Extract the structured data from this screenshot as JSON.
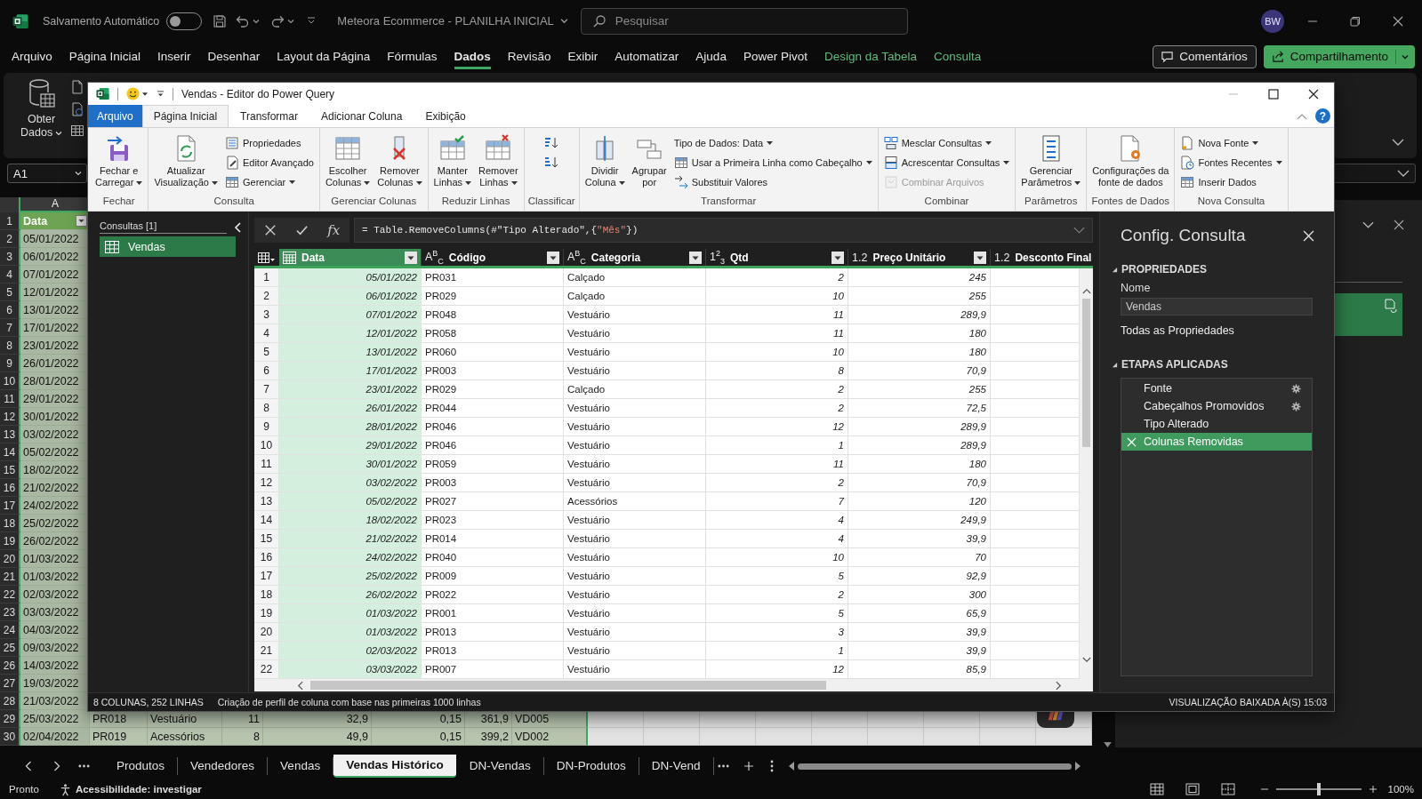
{
  "excel": {
    "title_bar": {
      "autosave": {
        "label": "Salvamento Automático",
        "on": false
      },
      "document_title": "Meteora Ecommerce - PLANILHA INICIAL",
      "search": {
        "placeholder": "Pesquisar"
      },
      "account_initials": "BW"
    },
    "menu_tabs": [
      {
        "label": "Arquivo",
        "selected": false,
        "kind": "standard"
      },
      {
        "label": "Página Inicial",
        "selected": false,
        "kind": "standard"
      },
      {
        "label": "Inserir",
        "selected": false,
        "kind": "standard"
      },
      {
        "label": "Desenhar",
        "selected": false,
        "kind": "standard"
      },
      {
        "label": "Layout da Página",
        "selected": false,
        "kind": "standard"
      },
      {
        "label": "Fórmulas",
        "selected": false,
        "kind": "standard"
      },
      {
        "label": "Dados",
        "selected": true,
        "kind": "standard"
      },
      {
        "label": "Revisão",
        "selected": false,
        "kind": "standard"
      },
      {
        "label": "Exibir",
        "selected": false,
        "kind": "standard"
      },
      {
        "label": "Automatizar",
        "selected": false,
        "kind": "standard"
      },
      {
        "label": "Ajuda",
        "selected": false,
        "kind": "standard"
      },
      {
        "label": "Power Pivot",
        "selected": false,
        "kind": "standard"
      },
      {
        "label": "Design da Tabela",
        "selected": false,
        "kind": "contextual"
      },
      {
        "label": "Consulta",
        "selected": false,
        "kind": "contextual"
      }
    ],
    "comments_button": "Comentários",
    "share_button": "Compartilhamento",
    "ribbon": {
      "get_data_button": "Obter\nDados"
    },
    "name_box": "A1",
    "sheet": {
      "column_headers": [
        "A"
      ],
      "rows": [
        {
          "number": "1",
          "kind": "header",
          "cells": [
            "Data"
          ]
        },
        {
          "number": "2",
          "kind": "data",
          "cells": [
            "05/01/2022"
          ]
        },
        {
          "number": "3",
          "kind": "data",
          "cells": [
            "06/01/2022"
          ]
        },
        {
          "number": "4",
          "kind": "data",
          "cells": [
            "07/01/2022"
          ]
        },
        {
          "number": "5",
          "kind": "data",
          "cells": [
            "12/01/2022"
          ]
        },
        {
          "number": "6",
          "kind": "data",
          "cells": [
            "13/01/2022"
          ]
        },
        {
          "number": "7",
          "kind": "data",
          "cells": [
            "17/01/2022"
          ]
        },
        {
          "number": "8",
          "kind": "data",
          "cells": [
            "23/01/2022"
          ]
        },
        {
          "number": "9",
          "kind": "data",
          "cells": [
            "26/01/2022"
          ]
        },
        {
          "number": "10",
          "kind": "data",
          "cells": [
            "28/01/2022"
          ]
        },
        {
          "number": "11",
          "kind": "data",
          "cells": [
            "29/01/2022"
          ]
        },
        {
          "number": "12",
          "kind": "data",
          "cells": [
            "30/01/2022"
          ]
        },
        {
          "number": "13",
          "kind": "data",
          "cells": [
            "03/02/2022"
          ]
        },
        {
          "number": "14",
          "kind": "data",
          "cells": [
            "05/02/2022"
          ]
        },
        {
          "number": "15",
          "kind": "data",
          "cells": [
            "18/02/2022"
          ]
        },
        {
          "number": "16",
          "kind": "data",
          "cells": [
            "21/02/2022"
          ]
        },
        {
          "number": "17",
          "kind": "data",
          "cells": [
            "24/02/2022"
          ]
        },
        {
          "number": "18",
          "kind": "data",
          "cells": [
            "25/02/2022"
          ]
        },
        {
          "number": "19",
          "kind": "data",
          "cells": [
            "26/02/2022"
          ]
        },
        {
          "number": "20",
          "kind": "data",
          "cells": [
            "01/03/2022"
          ]
        },
        {
          "number": "21",
          "kind": "data",
          "cells": [
            "01/03/2022"
          ]
        },
        {
          "number": "22",
          "kind": "data",
          "cells": [
            "02/03/2022"
          ]
        },
        {
          "number": "23",
          "kind": "data",
          "cells": [
            "03/03/2022"
          ]
        },
        {
          "number": "24",
          "kind": "data",
          "cells": [
            "04/03/2022"
          ]
        },
        {
          "number": "25",
          "kind": "data",
          "cells": [
            "09/03/2022"
          ]
        },
        {
          "number": "26",
          "kind": "data",
          "cells": [
            "14/03/2022"
          ]
        },
        {
          "number": "27",
          "kind": "data",
          "cells": [
            "19/03/2022"
          ]
        },
        {
          "number": "28",
          "kind": "data",
          "cells": [
            "21/03/2022"
          ]
        },
        {
          "number": "29",
          "kind": "data",
          "cells": [
            "25/03/2022",
            "PR018",
            "Vestuário",
            "11",
            "32,9",
            "0,15",
            "361,9",
            "VD005"
          ]
        },
        {
          "number": "30",
          "kind": "data",
          "cells": [
            "02/04/2022",
            "PR019",
            "Acessórios",
            "8",
            "49,9",
            "0,15",
            "399,2",
            "VD002"
          ]
        }
      ]
    },
    "sheet_tabs": [
      {
        "label": "Produtos",
        "selected": false
      },
      {
        "label": "Vendedores",
        "selected": false
      },
      {
        "label": "Vendas",
        "selected": false
      },
      {
        "label": "Vendas Histórico",
        "selected": true
      },
      {
        "label": "DN-Vendas",
        "selected": false
      },
      {
        "label": "DN-Produtos",
        "selected": false
      },
      {
        "label": "DN-Vend",
        "selected": false
      }
    ],
    "status_bar": {
      "status": "Pronto",
      "accessibility": "Acessibilidade: investigar",
      "zoom": {
        "level": 0.5,
        "label": "100%"
      }
    }
  },
  "power_query": {
    "title": "Vendas - Editor do Power Query",
    "tabs": [
      {
        "label": "Arquivo",
        "kind": "file",
        "selected": false
      },
      {
        "label": "Página Inicial",
        "kind": "tab",
        "selected": true
      },
      {
        "label": "Transformar",
        "kind": "tab",
        "selected": false
      },
      {
        "label": "Adicionar Coluna",
        "kind": "tab",
        "selected": false
      },
      {
        "label": "Exibição",
        "kind": "tab",
        "selected": false
      }
    ],
    "help_button": "?",
    "ribbon_groups": [
      {
        "label": "Fechar",
        "commands": [
          {
            "label": "Fechar e\nCarregar",
            "kind": "large",
            "dropdown": true,
            "disabled": false
          }
        ]
      },
      {
        "label": "Consulta",
        "commands": [
          {
            "label": "Atualizar\nVisualização",
            "kind": "large",
            "dropdown": true,
            "disabled": false
          },
          {
            "label": "Propriedades",
            "kind": "small",
            "dropdown": false,
            "disabled": false
          },
          {
            "label": "Editor Avançado",
            "kind": "small",
            "dropdown": false,
            "disabled": false
          },
          {
            "label": "Gerenciar",
            "kind": "small",
            "dropdown": true,
            "disabled": false
          }
        ]
      },
      {
        "label": "Gerenciar Colunas",
        "commands": [
          {
            "label": "Escolher\nColunas",
            "kind": "large",
            "dropdown": true,
            "disabled": false
          },
          {
            "label": "Remover\nColunas",
            "kind": "large",
            "dropdown": true,
            "disabled": false
          }
        ]
      },
      {
        "label": "Reduzir Linhas",
        "commands": [
          {
            "label": "Manter\nLinhas",
            "kind": "large",
            "dropdown": true,
            "disabled": false
          },
          {
            "label": "Remover\nLinhas",
            "kind": "large",
            "dropdown": true,
            "disabled": false
          }
        ]
      },
      {
        "label": "Classificar",
        "commands": [
          {
            "kind": "icon",
            "dropdown": false,
            "disabled": false
          },
          {
            "kind": "icon",
            "dropdown": false,
            "disabled": false
          }
        ]
      },
      {
        "label": "Transformar",
        "commands": [
          {
            "label": "Dividir\nColuna",
            "kind": "large",
            "dropdown": true,
            "disabled": false
          },
          {
            "label": "Agrupar\npor",
            "kind": "large",
            "dropdown": false,
            "disabled": false
          },
          {
            "label": "Tipo de Dados: Data",
            "kind": "small",
            "dropdown": true,
            "disabled": false
          },
          {
            "label": "Usar a Primeira Linha como Cabeçalho",
            "kind": "small",
            "dropdown": true,
            "disabled": false
          },
          {
            "label": "Substituir Valores",
            "kind": "small",
            "dropdown": false,
            "disabled": false
          }
        ]
      },
      {
        "label": "Combinar",
        "commands": [
          {
            "label": "Mesclar Consultas",
            "kind": "small",
            "dropdown": true,
            "disabled": false
          },
          {
            "label": "Acrescentar Consultas",
            "kind": "small",
            "dropdown": true,
            "disabled": false
          },
          {
            "label": "Combinar Arquivos",
            "kind": "small",
            "dropdown": false,
            "disabled": true
          }
        ]
      },
      {
        "label": "Parâmetros",
        "commands": [
          {
            "label": "Gerenciar\nParâmetros",
            "kind": "large",
            "dropdown": true,
            "disabled": false
          }
        ]
      },
      {
        "label": "Fontes de Dados",
        "commands": [
          {
            "label": "Configurações da\nfonte de dados",
            "kind": "large",
            "dropdown": false,
            "disabled": false
          }
        ]
      },
      {
        "label": "Nova Consulta",
        "commands": [
          {
            "label": "Nova Fonte",
            "kind": "small",
            "dropdown": true,
            "disabled": false
          },
          {
            "label": "Fontes Recentes",
            "kind": "small",
            "dropdown": true,
            "disabled": false
          },
          {
            "label": "Inserir Dados",
            "kind": "small",
            "dropdown": false,
            "disabled": false
          }
        ]
      }
    ],
    "queries_pane": {
      "title": "Consultas [1]",
      "items": [
        {
          "label": "Vendas",
          "selected": true
        }
      ]
    },
    "formula_bar": {
      "function_label": "fx",
      "formula_parts": [
        {
          "kind": "code",
          "text": "= Table.RemoveColumns(#\"Tipo Alterado\",{"
        },
        {
          "kind": "string",
          "text": "\"Mês\""
        },
        {
          "kind": "code",
          "text": "})"
        }
      ]
    },
    "grid": {
      "columns": [
        {
          "name": "Data",
          "kind": "date",
          "selected": true
        },
        {
          "name": "Código",
          "kind": "text",
          "type_label": "A$^{B}$$_{C}$",
          "selected": false
        },
        {
          "name": "Categoria",
          "kind": "text",
          "type_label": "A$^{B}$$_{C}$",
          "selected": false
        },
        {
          "name": "Qtd",
          "kind": "integer",
          "type_label": "1$^{2}$$_{3}$",
          "selected": false
        },
        {
          "name": "Preço Unitário",
          "kind": "decimal",
          "type_label": "1.2",
          "selected": false
        },
        {
          "name": "Desconto Final",
          "kind": "decimal",
          "type_label": "1.2",
          "selected": false
        }
      ],
      "rows": [
        {
          "number": "1",
          "cells": [
            "05/01/2022",
            "PR031",
            "Calçado",
            "2",
            "245"
          ]
        },
        {
          "number": "2",
          "cells": [
            "06/01/2022",
            "PR029",
            "Calçado",
            "10",
            "255"
          ]
        },
        {
          "number": "3",
          "cells": [
            "07/01/2022",
            "PR048",
            "Vestuário",
            "11",
            "289,9"
          ]
        },
        {
          "number": "4",
          "cells": [
            "12/01/2022",
            "PR058",
            "Vestuário",
            "11",
            "180"
          ]
        },
        {
          "number": "5",
          "cells": [
            "13/01/2022",
            "PR060",
            "Vestuário",
            "10",
            "180"
          ]
        },
        {
          "number": "6",
          "cells": [
            "17/01/2022",
            "PR003",
            "Vestuário",
            "8",
            "70,9"
          ]
        },
        {
          "number": "7",
          "cells": [
            "23/01/2022",
            "PR029",
            "Calçado",
            "2",
            "255"
          ]
        },
        {
          "number": "8",
          "cells": [
            "26/01/2022",
            "PR044",
            "Vestuário",
            "2",
            "72,5"
          ]
        },
        {
          "number": "9",
          "cells": [
            "28/01/2022",
            "PR046",
            "Vestuário",
            "12",
            "289,9"
          ]
        },
        {
          "number": "10",
          "cells": [
            "29/01/2022",
            "PR046",
            "Vestuário",
            "1",
            "289,9"
          ]
        },
        {
          "number": "11",
          "cells": [
            "30/01/2022",
            "PR059",
            "Vestuário",
            "11",
            "180"
          ]
        },
        {
          "number": "12",
          "cells": [
            "03/02/2022",
            "PR003",
            "Vestuário",
            "2",
            "70,9"
          ]
        },
        {
          "number": "13",
          "cells": [
            "05/02/2022",
            "PR027",
            "Acessórios",
            "7",
            "120"
          ]
        },
        {
          "number": "14",
          "cells": [
            "18/02/2022",
            "PR023",
            "Vestuário",
            "4",
            "249,9"
          ]
        },
        {
          "number": "15",
          "cells": [
            "21/02/2022",
            "PR014",
            "Vestuário",
            "4",
            "39,9"
          ]
        },
        {
          "number": "16",
          "cells": [
            "24/02/2022",
            "PR040",
            "Vestuário",
            "10",
            "70"
          ]
        },
        {
          "number": "17",
          "cells": [
            "25/02/2022",
            "PR009",
            "Vestuário",
            "5",
            "92,9"
          ]
        },
        {
          "number": "18",
          "cells": [
            "26/02/2022",
            "PR022",
            "Vestuário",
            "2",
            "300"
          ]
        },
        {
          "number": "19",
          "cells": [
            "01/03/2022",
            "PR001",
            "Vestuário",
            "5",
            "65,9"
          ]
        },
        {
          "number": "20",
          "cells": [
            "01/03/2022",
            "PR013",
            "Vestuário",
            "3",
            "39,9"
          ]
        },
        {
          "number": "21",
          "cells": [
            "02/03/2022",
            "PR013",
            "Vestuário",
            "1",
            "39,9"
          ]
        },
        {
          "number": "22",
          "cells": [
            "03/03/2022",
            "PR007",
            "Vestuário",
            "12",
            "85,9"
          ]
        }
      ]
    },
    "settings_pane": {
      "title": "Config. Consulta",
      "properties": {
        "heading": "PROPRIEDADES",
        "expanded": true,
        "name_label": "Nome",
        "name_value": "Vendas",
        "all_properties_link": "Todas as Propriedades"
      },
      "applied_steps": {
        "heading": "ETAPAS APLICADAS",
        "expanded": true,
        "items": [
          {
            "label": "Fonte",
            "selected": false,
            "has_settings": true
          },
          {
            "label": "Cabeçalhos Promovidos",
            "selected": false,
            "has_settings": true
          },
          {
            "label": "Tipo Alterado",
            "selected": false,
            "has_settings": false
          },
          {
            "label": "Colunas Removidas",
            "selected": true,
            "has_settings": false
          }
        ]
      }
    },
    "status_bar": {
      "size": "8 COLUNAS, 252 LINHAS",
      "profiling": "Criação de perfil de coluna com base nas primeiras 1000 linhas",
      "preview_time": "VISUALIZAÇÃO BAIXADA À(S) 15:03"
    }
  }
}
